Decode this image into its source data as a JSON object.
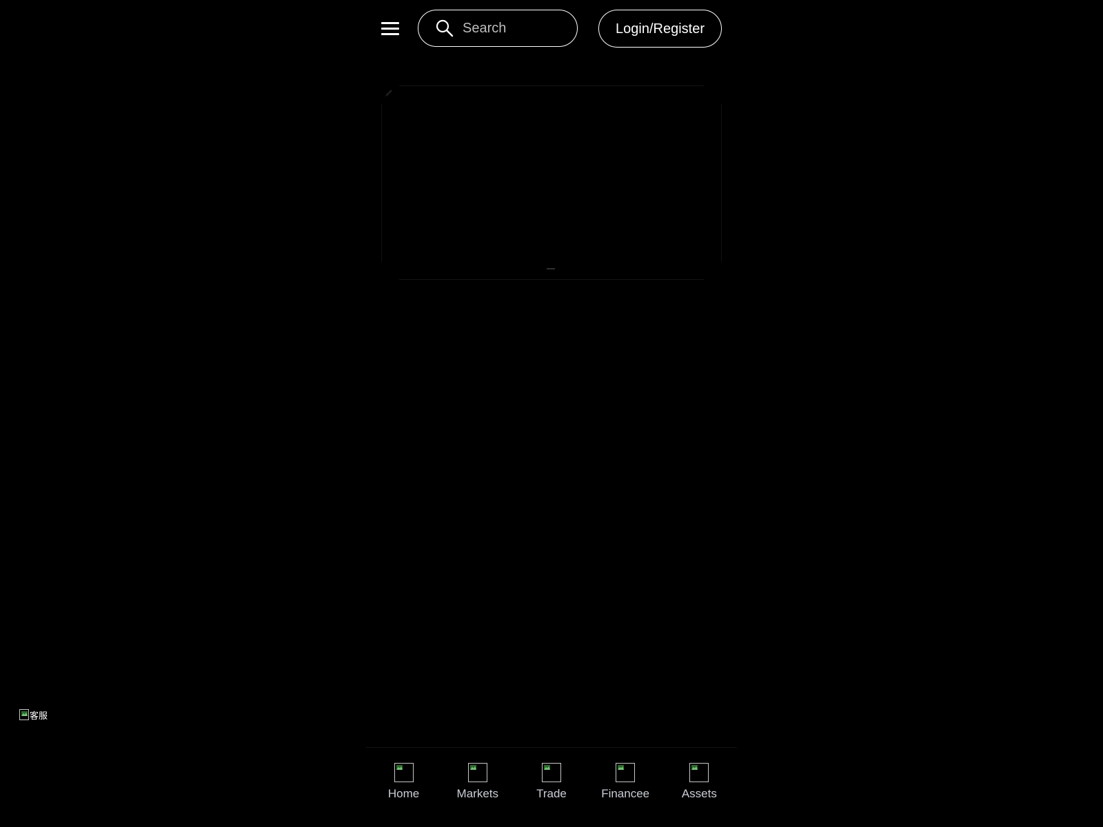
{
  "header": {
    "menu_icon": "hamburger-menu-icon",
    "search": {
      "icon": "search-icon",
      "placeholder": "Search",
      "value": ""
    },
    "login_label": "Login/Register"
  },
  "banner": {
    "edit_icon": "pencil-icon"
  },
  "customer_service": {
    "alt_text": "客服",
    "icon": "broken-image-icon"
  },
  "bottom_nav": {
    "items": [
      {
        "label": "Home",
        "icon": "broken-image-icon"
      },
      {
        "label": "Markets",
        "icon": "broken-image-icon"
      },
      {
        "label": "Trade",
        "icon": "broken-image-icon"
      },
      {
        "label": "Financee",
        "icon": "broken-image-icon"
      },
      {
        "label": "Assets",
        "icon": "broken-image-icon"
      }
    ]
  },
  "colors": {
    "background": "#000000",
    "foreground": "#ffffff",
    "nav_label": "#c9cdd4",
    "placeholder": "#bdbdbd"
  }
}
